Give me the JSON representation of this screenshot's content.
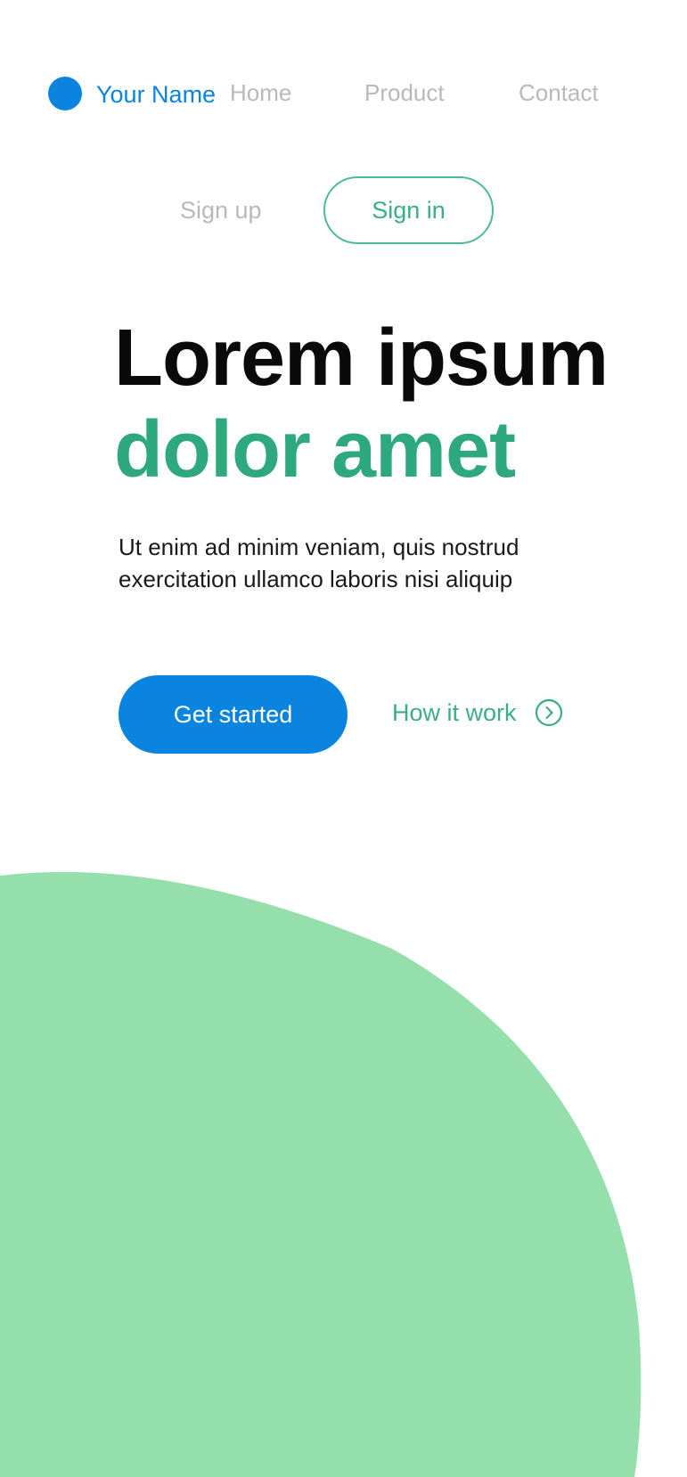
{
  "header": {
    "brand_name": "Your Name",
    "nav": [
      "Home",
      "Product",
      "Contact"
    ],
    "sign_up_label": "Sign up",
    "sign_in_label": "Sign in"
  },
  "hero": {
    "title_line_1": "Lorem ipsum",
    "title_line_2": "dolor amet",
    "description": "Ut enim ad minim veniam, quis nostrud exercitation ullamco laboris nisi aliquip",
    "primary_cta_label": "Get started",
    "secondary_cta_label": "How it work",
    "secondary_cta_icon": "chevron-right-circle-icon"
  },
  "colors": {
    "brand_blue": "#0b84e0",
    "accent_green": "#2ea87d",
    "blob_green": "#94dfab",
    "nav_gray": "#b9b9b9"
  }
}
